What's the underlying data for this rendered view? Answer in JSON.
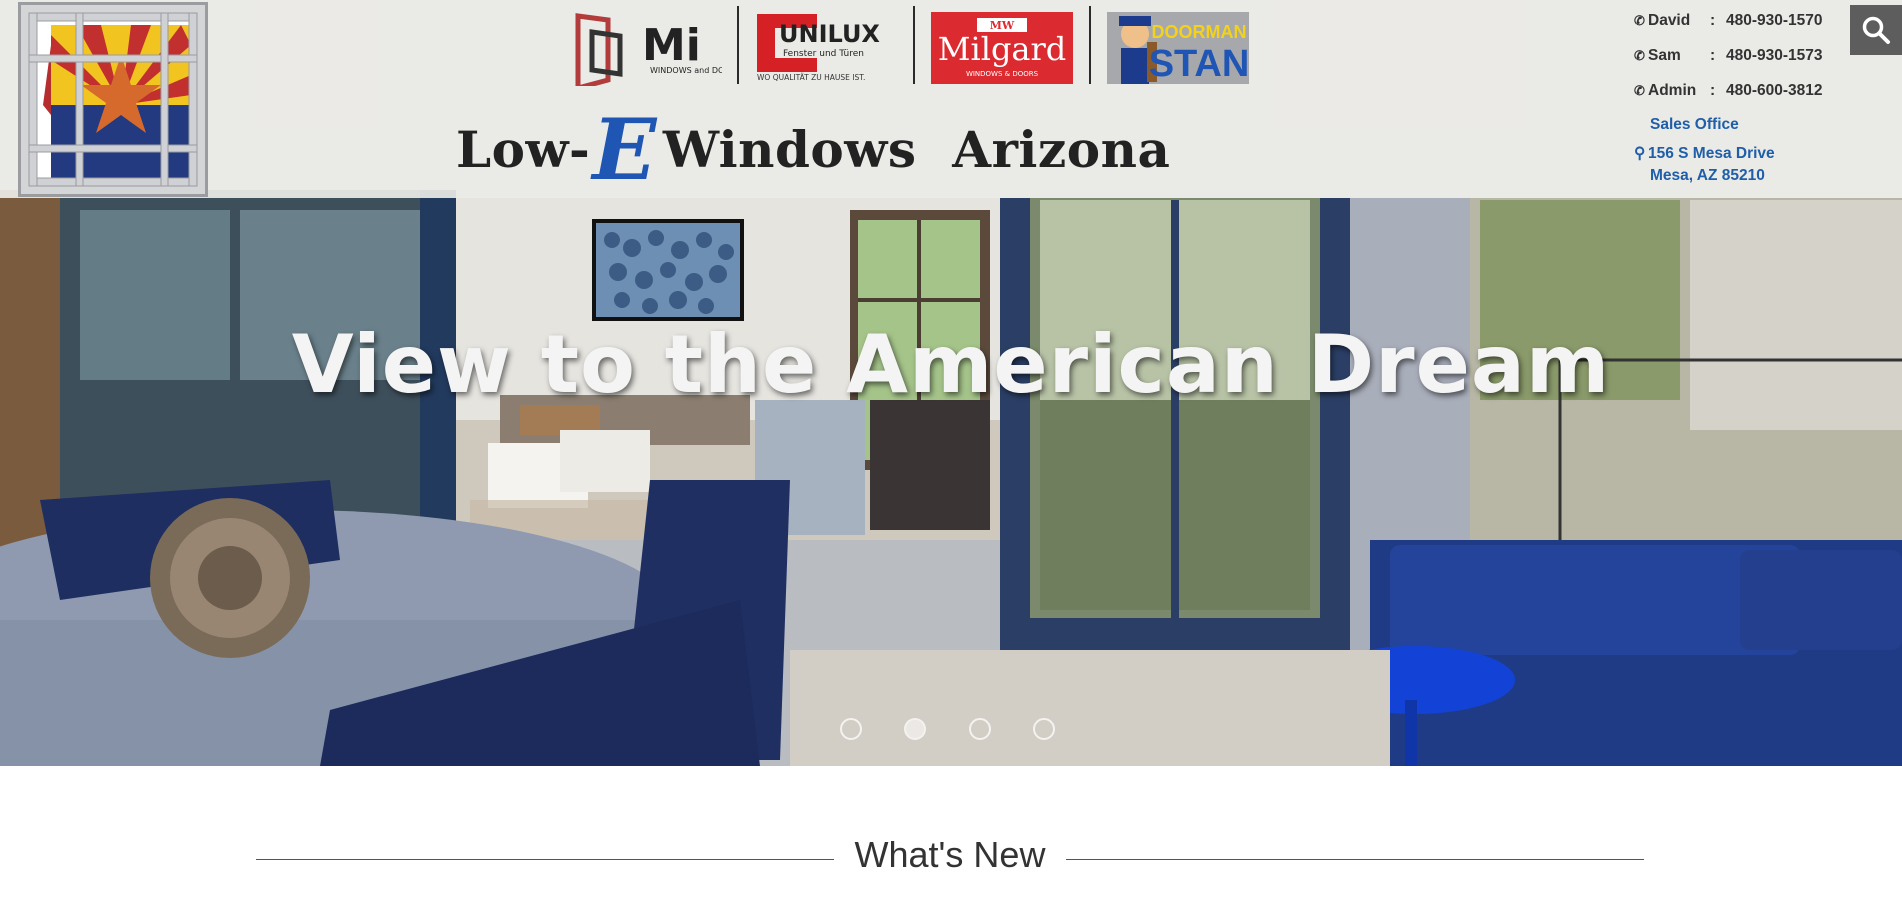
{
  "header": {
    "site_title_prefix": "Low-",
    "site_title_e": "E",
    "site_title_suffix": "Windows  Arizona",
    "brands": [
      {
        "name": "Mi",
        "tagline": "WINDOWS and DOORS"
      },
      {
        "name": "UNILUX",
        "tagline": "Fenster und Türen",
        "subline": "WO QUALITÄT ZU HAUSE IST."
      },
      {
        "name": "Milgard",
        "tagline": "WINDOWS & DOORS",
        "mark": "MW"
      },
      {
        "name": "STAN",
        "tagline": "DOORMAN"
      }
    ]
  },
  "contacts": [
    {
      "name": "David",
      "phone": "480-930-1570",
      "icon": "phone-icon"
    },
    {
      "name": "Sam",
      "phone": "480-930-1573",
      "icon": "phone-icon"
    },
    {
      "name": "Admin",
      "phone": "480-600-3812",
      "icon": "phone-icon"
    }
  ],
  "office": {
    "label": "Sales Office",
    "line1": "156 S Mesa Drive",
    "line2": "Mesa, AZ 85210",
    "icon": "map-marker-icon"
  },
  "search": {
    "icon": "search-icon"
  },
  "hero": {
    "headline": "View to the American Dream",
    "slides": 4,
    "active_slide": 2
  },
  "section": {
    "title": "What's New"
  },
  "colors": {
    "accent_blue": "#1f5ea8",
    "title_e_blue": "#1f56b4",
    "milgard_red": "#dc2b30",
    "unilux_red": "#d52026",
    "search_bg": "#5d5d5d"
  }
}
